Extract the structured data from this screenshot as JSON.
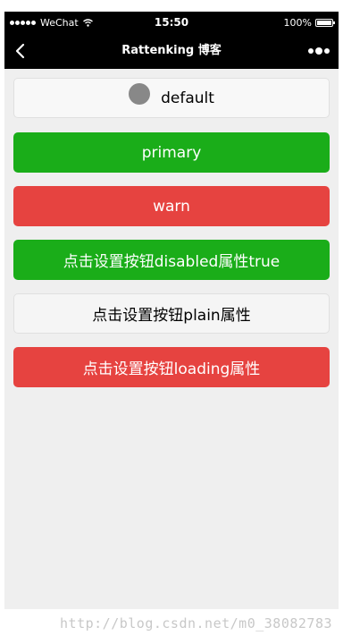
{
  "status_bar": {
    "carrier": "WeChat",
    "time": "15:50",
    "battery": "100%",
    "battery_level": 1.0
  },
  "nav": {
    "title": "Rattenking 博客",
    "back_icon": "chevron-left-icon",
    "more_icon": "more-dots-icon"
  },
  "buttons": {
    "default_label": "default",
    "primary_label": "primary",
    "warn_label": "warn",
    "disabled_toggle_label": "点击设置按钮disabled属性true",
    "plain_toggle_label": "点击设置按钮plain属性",
    "loading_toggle_label": "点击设置按钮loading属性"
  },
  "colors": {
    "primary": "#1aad19",
    "warn": "#e64340",
    "navbar": "#000000",
    "page_bg": "#efefef"
  },
  "watermark": "http://blog.csdn.net/m0_38082783"
}
